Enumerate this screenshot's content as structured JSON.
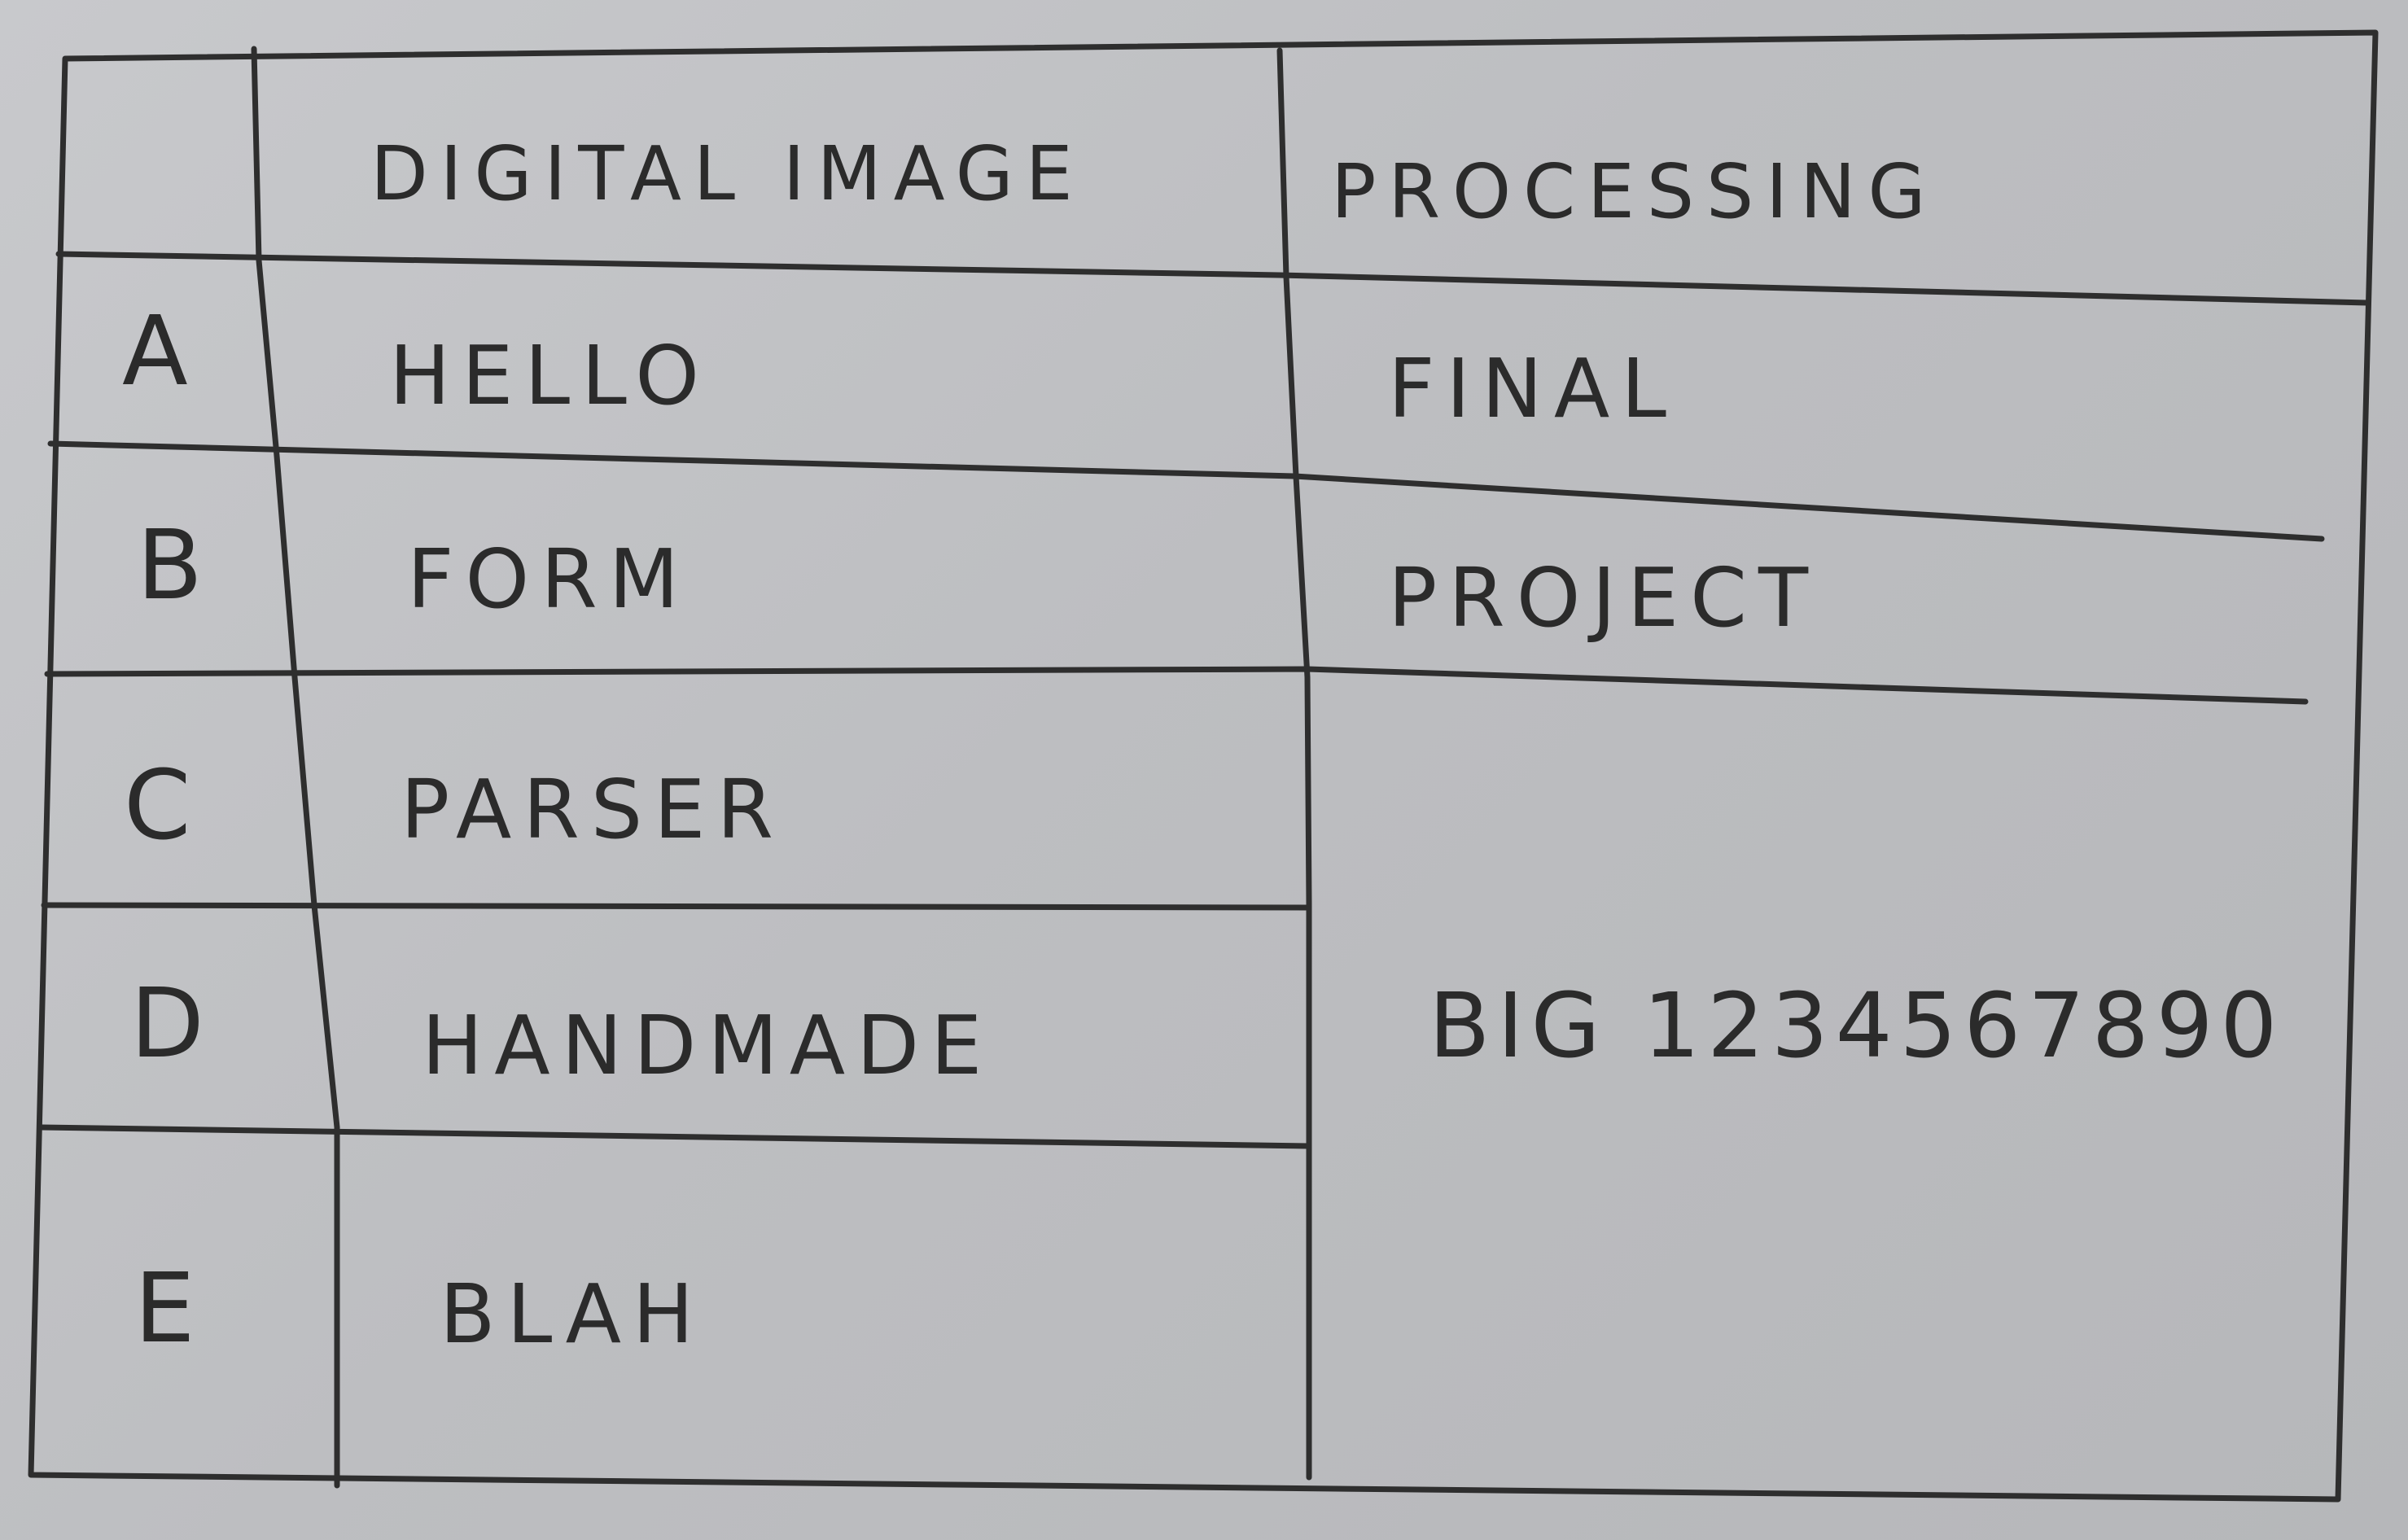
{
  "table": {
    "header": {
      "col1": "DIGITAL   IMAGE",
      "col2": "PROCESSING"
    },
    "rows": [
      {
        "label": "A",
        "col1": "HELLO",
        "col2": "FINAL"
      },
      {
        "label": "B",
        "col1": "FORM",
        "col2": "PROJECT"
      },
      {
        "label": "C",
        "col1": "PARSER"
      },
      {
        "label": "D",
        "col1": "HANDMADE"
      },
      {
        "label": "E",
        "col1": "BLAH"
      }
    ],
    "merged_cell": "BIG 1234567890"
  },
  "colors": {
    "paper": "#c4c5c8",
    "ink": "#2b2b2b"
  }
}
